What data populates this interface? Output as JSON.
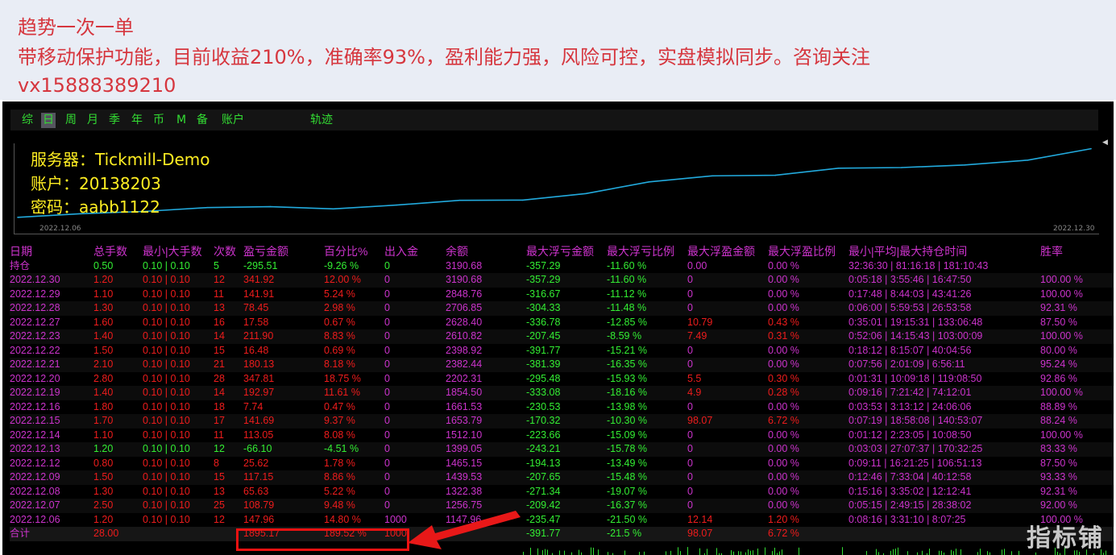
{
  "banner": {
    "line1": "趋势一次一单",
    "line2": "带移动保护功能，目前收益210%，准确率93%，盈利能力强，风险可控，实盘模拟同步。咨询关注",
    "line3": "vx15888389210"
  },
  "tabs": [
    "综",
    "日",
    "周",
    "月",
    "季",
    "年",
    "币",
    "M",
    "备",
    "账户",
    "轨迹"
  ],
  "active_tab": "日",
  "info": {
    "server": "服务器：Tickmill-Demo",
    "account": "账户：20138203",
    "password": "密码：aabb1122"
  },
  "chart_data": {
    "type": "line",
    "x_start": "2022.12.06",
    "x_end": "2022.12.30",
    "x": [
      "2022.12.06",
      "2022.12.07",
      "2022.12.08",
      "2022.12.09",
      "2022.12.12",
      "2022.12.13",
      "2022.12.14",
      "2022.12.15",
      "2022.12.16",
      "2022.12.19",
      "2022.12.20",
      "2022.12.21",
      "2022.12.22",
      "2022.12.23",
      "2022.12.27",
      "2022.12.28",
      "2022.12.29",
      "2022.12.30"
    ],
    "values": [
      1147.96,
      1256.75,
      1322.38,
      1439.53,
      1465.15,
      1399.05,
      1512.1,
      1653.79,
      1661.53,
      1854.5,
      2202.31,
      2382.44,
      2398.92,
      2610.82,
      2628.4,
      2706.85,
      2848.76,
      3190.68
    ],
    "line_color": "#22aadd"
  },
  "table": {
    "headers": [
      "日期",
      "总手数",
      "最小|大手数",
      "次数",
      "盈亏金额",
      "百分比%",
      "出入金",
      "余额",
      "最大浮亏金额",
      "最大浮亏比例",
      "最大浮盈金额",
      "最大浮盈比例",
      "最小|平均|最大持仓时间",
      "胜率"
    ],
    "holding": [
      "持仓",
      "0.50",
      "0.10 | 0.10",
      "5",
      "-295.51",
      "-9.26 %",
      "0",
      "3190.68",
      "-357.29",
      "-11.60 %",
      "0.00",
      "0.00 %",
      "32:36:30 | 81:16:18 | 181:10:43",
      ""
    ],
    "rows": [
      [
        "2022.12.30",
        "1.20",
        "0.10 | 0.10",
        "12",
        "341.92",
        "12.00 %",
        "0",
        "3190.68",
        "-357.29",
        "-11.60 %",
        "0",
        "0.00 %",
        "0:05:18 | 3:55:46 | 16:47:50",
        "100.00 %"
      ],
      [
        "2022.12.29",
        "1.10",
        "0.10 | 0.10",
        "11",
        "141.91",
        "5.24 %",
        "0",
        "2848.76",
        "-316.67",
        "-11.12 %",
        "0",
        "0.00 %",
        "0:17:48 | 8:44:03 | 43:41:26",
        "100.00 %"
      ],
      [
        "2022.12.28",
        "1.30",
        "0.10 | 0.10",
        "13",
        "78.45",
        "2.98 %",
        "0",
        "2706.85",
        "-304.33",
        "-11.48 %",
        "0",
        "0.00 %",
        "0:06:00 | 5:59:53 | 26:53:58",
        "92.31 %"
      ],
      [
        "2022.12.27",
        "1.60",
        "0.10 | 0.10",
        "16",
        "17.58",
        "0.67 %",
        "0",
        "2628.40",
        "-336.78",
        "-12.85 %",
        "10.79",
        "0.43 %",
        "0:35:01 | 19:15:31 | 133:06:48",
        "87.50 %"
      ],
      [
        "2022.12.23",
        "1.40",
        "0.10 | 0.10",
        "14",
        "211.90",
        "8.83 %",
        "0",
        "2610.82",
        "-207.45",
        "-8.59 %",
        "7.49",
        "0.31 %",
        "0:52:06 | 14:15:43 | 103:00:09",
        "100.00 %"
      ],
      [
        "2022.12.22",
        "1.50",
        "0.10 | 0.10",
        "15",
        "16.48",
        "0.69 %",
        "0",
        "2398.92",
        "-391.77",
        "-15.21 %",
        "0",
        "0.00 %",
        "0:18:12 | 8:15:07 | 40:04:56",
        "80.00 %"
      ],
      [
        "2022.12.21",
        "2.10",
        "0.10 | 0.10",
        "21",
        "180.13",
        "8.18 %",
        "0",
        "2382.44",
        "-381.39",
        "-16.35 %",
        "0",
        "0.00 %",
        "0:07:56 | 2:01:09 | 6:56:11",
        "95.24 %"
      ],
      [
        "2022.12.20",
        "2.80",
        "0.10 | 0.10",
        "28",
        "347.81",
        "18.75 %",
        "0",
        "2202.31",
        "-295.48",
        "-15.93 %",
        "5.5",
        "0.30 %",
        "0:01:31 | 10:09:18 | 119:08:50",
        "92.86 %"
      ],
      [
        "2022.12.19",
        "1.40",
        "0.10 | 0.10",
        "14",
        "192.97",
        "11.61 %",
        "0",
        "1854.50",
        "-333.08",
        "-18.16 %",
        "4.9",
        "0.28 %",
        "0:09:16 | 7:21:42 | 74:12:01",
        "100.00 %"
      ],
      [
        "2022.12.16",
        "1.80",
        "0.10 | 0.10",
        "18",
        "7.74",
        "0.47 %",
        "0",
        "1661.53",
        "-230.53",
        "-13.98 %",
        "0",
        "0.00 %",
        "0:03:53 | 3:13:12 | 24:06:06",
        "88.89 %"
      ],
      [
        "2022.12.15",
        "1.70",
        "0.10 | 0.10",
        "17",
        "141.69",
        "9.37 %",
        "0",
        "1653.79",
        "-170.32",
        "-10.30 %",
        "98.07",
        "6.72 %",
        "0:07:19 | 18:58:08 | 140:53:07",
        "88.24 %"
      ],
      [
        "2022.12.14",
        "1.10",
        "0.10 | 0.10",
        "11",
        "113.05",
        "8.08 %",
        "0",
        "1512.10",
        "-223.66",
        "-15.09 %",
        "0",
        "0.00 %",
        "0:01:12 | 2:23:05 | 10:08:50",
        "100.00 %"
      ],
      [
        "2022.12.13",
        "1.20",
        "0.10 | 0.10",
        "12",
        "-66.10",
        "-4.51 %",
        "0",
        "1399.05",
        "-243.21",
        "-15.78 %",
        "0",
        "0.00 %",
        "0:03:03 | 27:07:37 | 170:32:25",
        "83.33 %"
      ],
      [
        "2022.12.12",
        "0.80",
        "0.10 | 0.10",
        "8",
        "25.62",
        "1.78 %",
        "0",
        "1465.15",
        "-194.13",
        "-13.49 %",
        "0",
        "0.00 %",
        "0:09:11 | 16:21:25 | 106:51:13",
        "87.50 %"
      ],
      [
        "2022.12.09",
        "1.50",
        "0.10 | 0.10",
        "15",
        "117.15",
        "8.86 %",
        "0",
        "1439.53",
        "-207.65",
        "-15.48 %",
        "0",
        "0.00 %",
        "0:12:46 | 7:33:04 | 40:12:58",
        "93.33 %"
      ],
      [
        "2022.12.08",
        "1.30",
        "0.10 | 0.10",
        "13",
        "65.63",
        "5.22 %",
        "0",
        "1322.38",
        "-271.34",
        "-19.07 %",
        "0",
        "0.00 %",
        "0:15:16 | 3:35:02 | 12:12:41",
        "92.31 %"
      ],
      [
        "2022.12.07",
        "2.50",
        "0.10 | 0.10",
        "25",
        "108.79",
        "9.48 %",
        "0",
        "1256.75",
        "-209.42",
        "-16.37 %",
        "0",
        "0.00 %",
        "0:05:15 | 2:49:15 | 28:38:02",
        "92.00 %"
      ],
      [
        "2022.12.06",
        "1.20",
        "0.10 | 0.10",
        "12",
        "147.96",
        "14.80 %",
        "1000",
        "1147.96",
        "-235.47",
        "-21.50 %",
        "12.14",
        "1.20 %",
        "0:08:16 | 3:31:10 | 8:07:25",
        "100.00 %"
      ]
    ],
    "total": [
      "合计",
      "28.00",
      "",
      "",
      "1895.17",
      "189.52 %",
      "1000",
      "",
      "-391.77",
      "-21.5 %",
      "98.07",
      "6.72 %",
      "",
      ""
    ]
  },
  "colors": {
    "profit": "#ee1c1c",
    "loss": "#33ee33",
    "neutral": "#cc33cc",
    "header": "#cc33cc"
  },
  "watermark": "指标铺"
}
